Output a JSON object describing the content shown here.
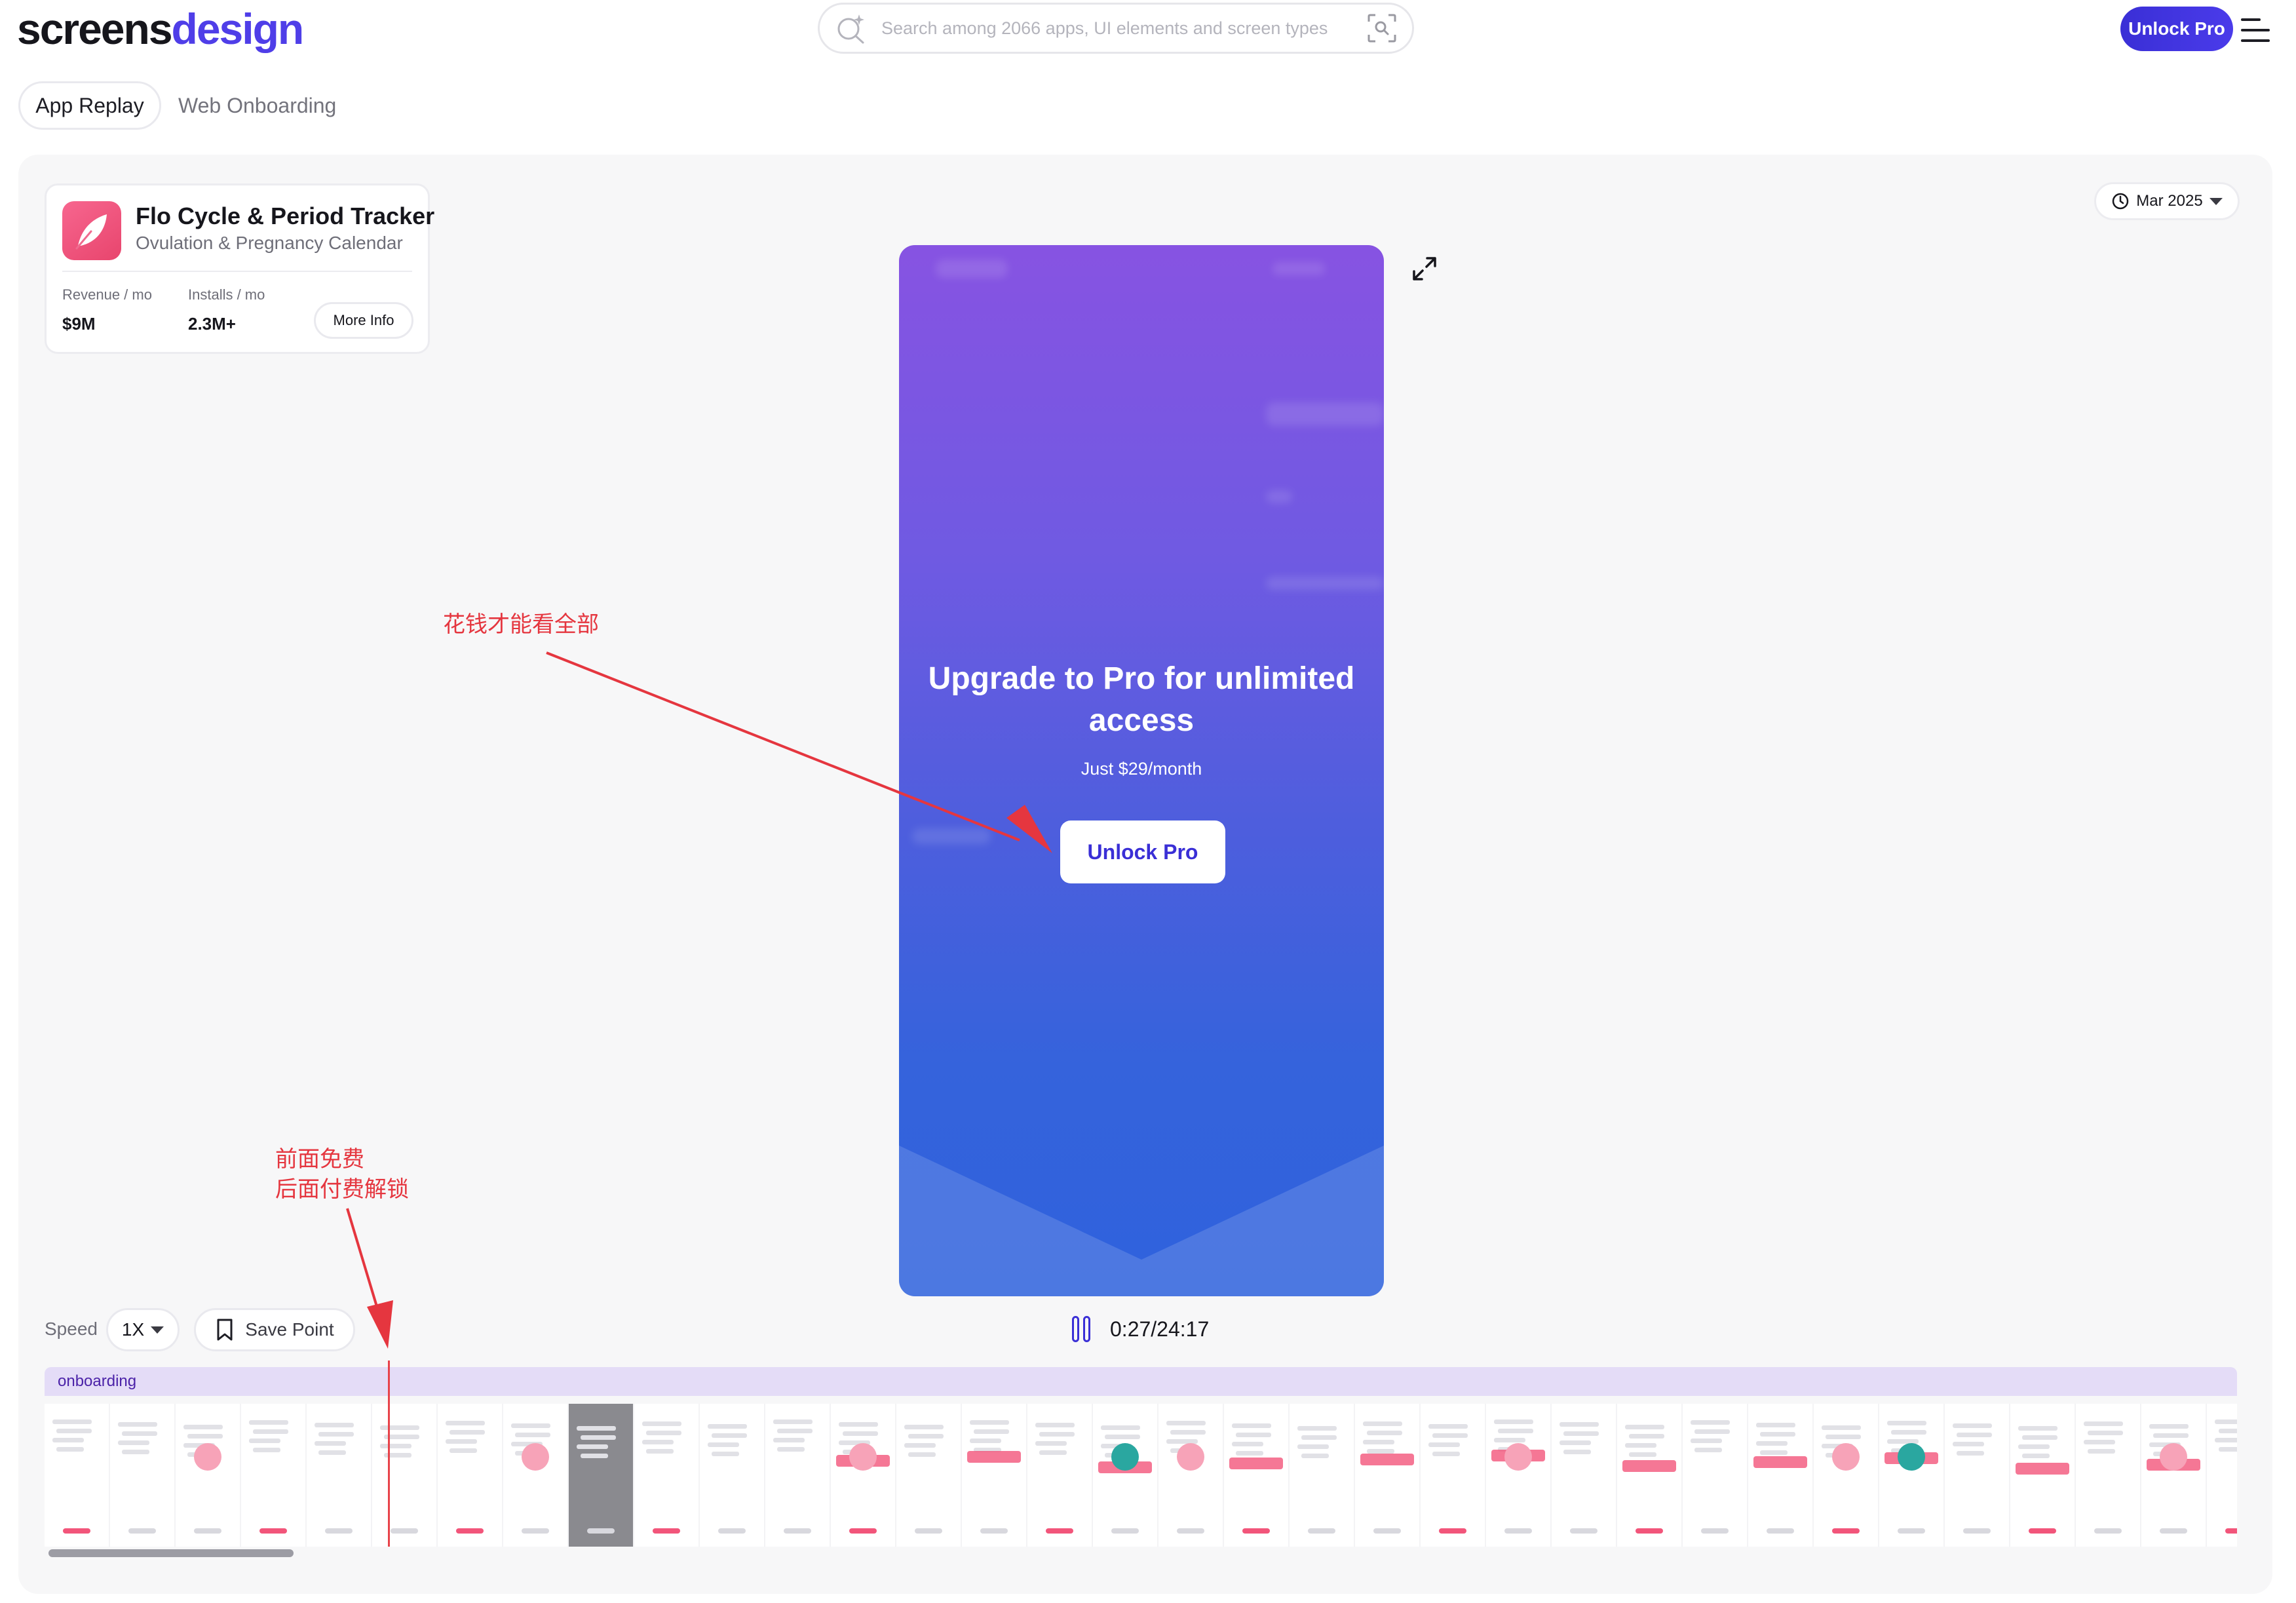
{
  "header": {
    "logo_part1": "screens",
    "logo_part2": "design",
    "search_placeholder": "Search among 2066 apps, UI elements and screen types",
    "unlock_label": "Unlock Pro"
  },
  "tabs": [
    {
      "label": "App Replay",
      "active": true
    },
    {
      "label": "Web Onboarding",
      "active": false
    }
  ],
  "app": {
    "title": "Flo Cycle & Period Tracker",
    "subtitle": "Ovulation & Pregnancy Calendar",
    "revenue_label": "Revenue / mo",
    "revenue_value": "$9M",
    "installs_label": "Installs / mo",
    "installs_value": "2.3M+",
    "more_info_label": "More Info"
  },
  "date_filter": {
    "value": "Mar 2025"
  },
  "paywall": {
    "title": "Upgrade to Pro for unlimited access",
    "price": "Just $29/month",
    "button": "Unlock Pro"
  },
  "playback": {
    "speed_label": "Speed",
    "speed_value": "1X",
    "save_point_label": "Save Point",
    "time": "0:27/24:17"
  },
  "timeline": {
    "section_label": "onboarding"
  },
  "annotations": {
    "top": "花钱才能看全部",
    "bottom_line1": "前面免费",
    "bottom_line2": "后面付费解锁"
  },
  "colors": {
    "accent": "#4a3bea",
    "annotation": "#e5363f",
    "brand_pink": "#f7668f",
    "timeline_section": "#e4dcf7"
  },
  "icons": {
    "search": "sparkle-search-icon",
    "scan": "image-search-icon",
    "menu": "menu-icon",
    "app": "flo-feather-icon",
    "clock": "clock-icon",
    "expand": "expand-icon",
    "pause": "pause-icon",
    "bookmark": "bookmark-icon"
  }
}
